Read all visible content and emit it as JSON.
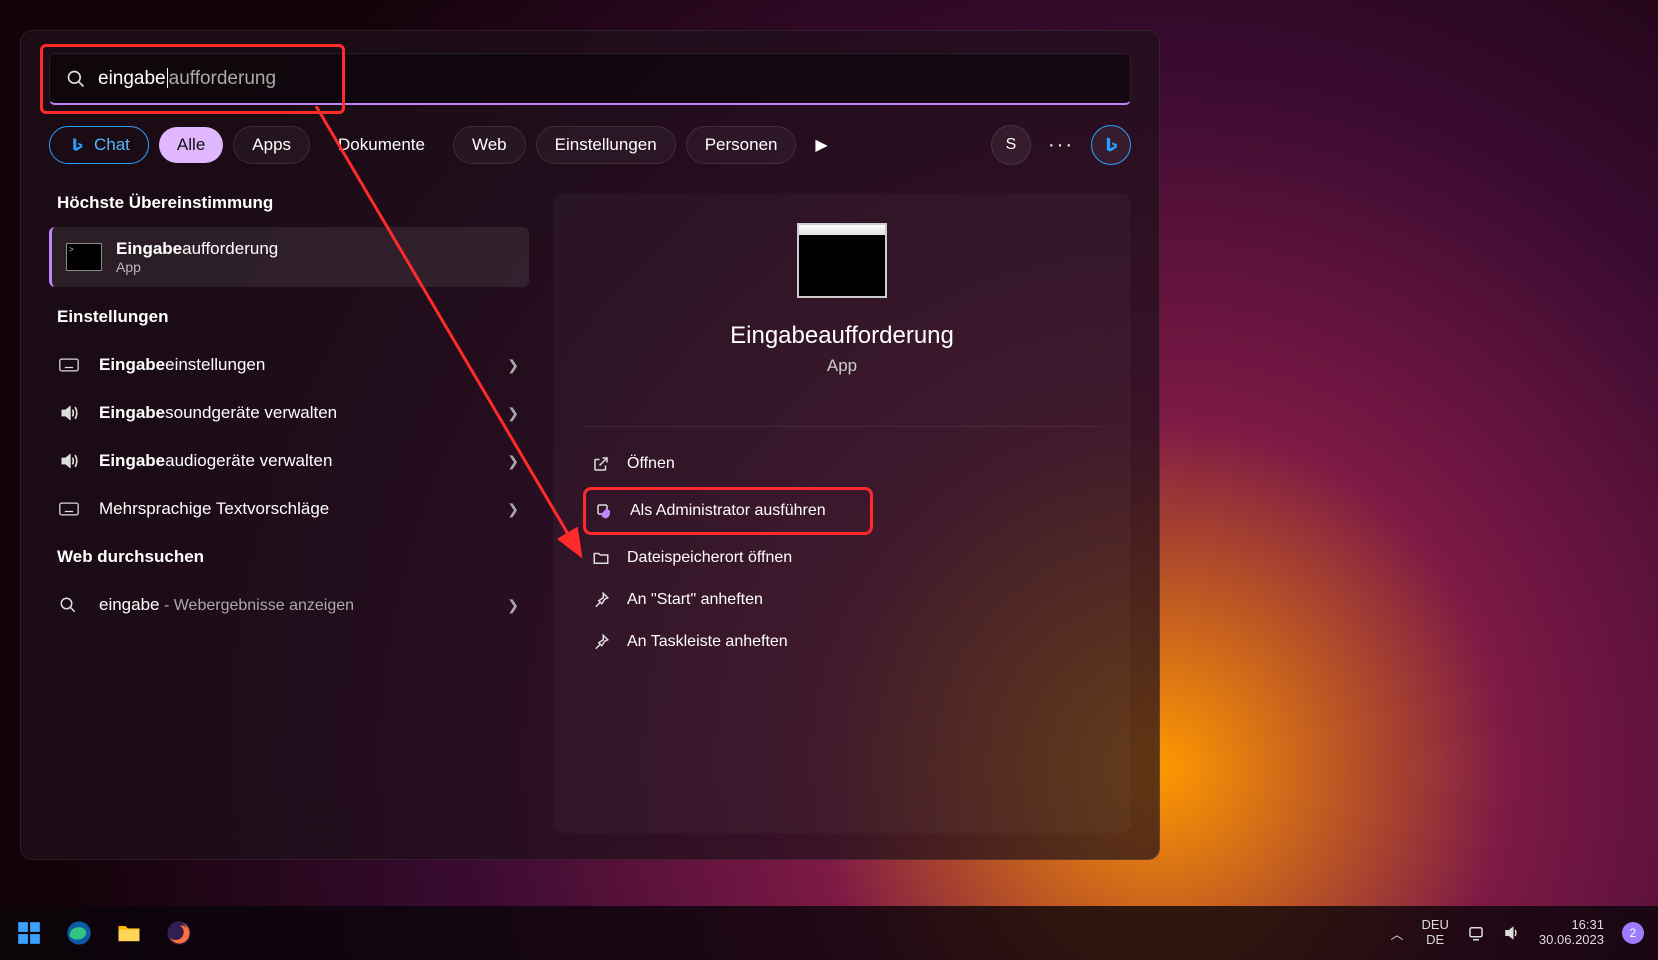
{
  "search": {
    "prefix": "eingabe",
    "suffix": "aufforderung"
  },
  "filters": {
    "chat": "Chat",
    "all": "Alle",
    "apps": "Apps",
    "docs": "Dokumente",
    "web": "Web",
    "settings": "Einstellungen",
    "people": "Personen",
    "profileInitial": "S"
  },
  "left": {
    "bestMatchHeader": "Höchste Übereinstimmung",
    "bestMatch": {
      "titleBold": "Eingabe",
      "titleRest": "aufforderung",
      "subtitle": "App"
    },
    "settingsHeader": "Einstellungen",
    "settingsItems": [
      {
        "bold": "Eingabe",
        "rest": "einstellungen",
        "icon": "keyboard"
      },
      {
        "bold": "Eingabe",
        "rest": "soundgeräte verwalten",
        "icon": "sound"
      },
      {
        "bold": "Eingabe",
        "rest": "audiogeräte verwalten",
        "icon": "sound"
      },
      {
        "bold": "",
        "rest": "Mehrsprachige Textvorschläge",
        "icon": "keyboard"
      }
    ],
    "webHeader": "Web durchsuchen",
    "webItem": {
      "term": "eingabe",
      "suffix": " - Webergebnisse anzeigen"
    }
  },
  "right": {
    "title": "Eingabeaufforderung",
    "subtitle": "App",
    "actions": [
      {
        "label": "Öffnen",
        "icon": "open"
      },
      {
        "label": "Als Administrator ausführen",
        "icon": "shield",
        "highlight": true
      },
      {
        "label": "Dateispeicherort öffnen",
        "icon": "folder"
      },
      {
        "label": "An \"Start\" anheften",
        "icon": "pin"
      },
      {
        "label": "An Taskleiste anheften",
        "icon": "pin"
      }
    ]
  },
  "taskbar": {
    "langTop": "DEU",
    "langBottom": "DE",
    "time": "16:31",
    "date": "30.06.2023",
    "badge": "2"
  }
}
